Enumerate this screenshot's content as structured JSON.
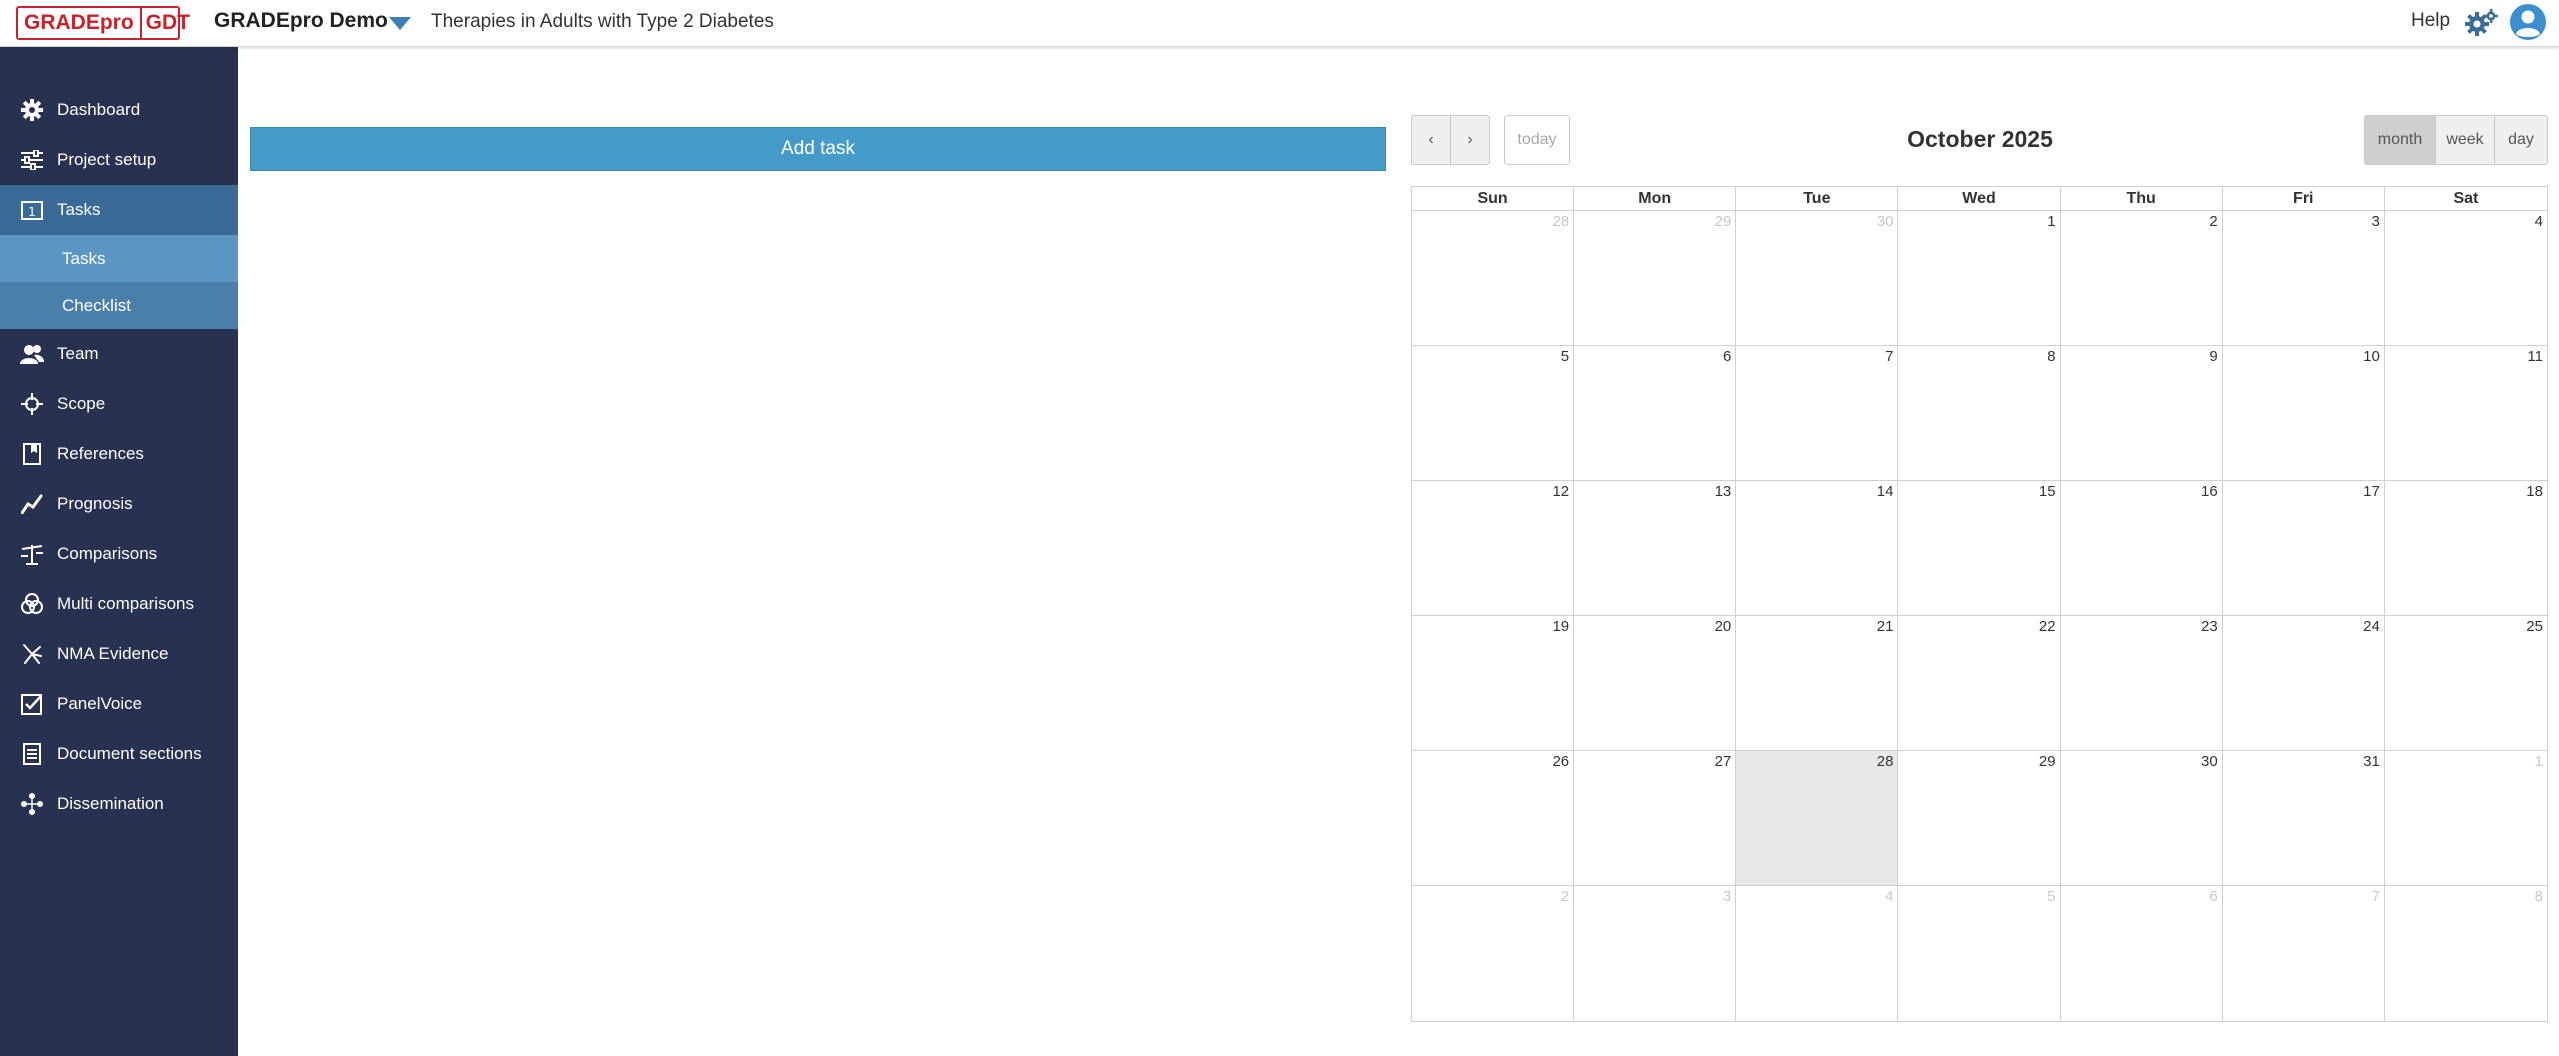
{
  "header": {
    "logo_left": "GRADEpro",
    "logo_right": "GDT",
    "project_name": "GRADEpro Demo",
    "project_title": "Therapies in Adults with Type 2 Diabetes",
    "help": "Help",
    "brand_color": "#c8232c",
    "accent_color": "#459bc8"
  },
  "sidebar": {
    "items": [
      {
        "label": "Dashboard",
        "icon": "gear-icon"
      },
      {
        "label": "Project setup",
        "icon": "sliders-icon"
      },
      {
        "label": "Tasks",
        "icon": "calendar-one-icon"
      },
      {
        "label": "Team",
        "icon": "people-icon"
      },
      {
        "label": "Scope",
        "icon": "crosshair-icon"
      },
      {
        "label": "References",
        "icon": "book-icon"
      },
      {
        "label": "Prognosis",
        "icon": "trend-icon"
      },
      {
        "label": "Comparisons",
        "icon": "scale-icon"
      },
      {
        "label": "Multi comparisons",
        "icon": "venn-icon"
      },
      {
        "label": "NMA Evidence",
        "icon": "network-icon"
      },
      {
        "label": "PanelVoice",
        "icon": "checkbox-icon"
      },
      {
        "label": "Document sections",
        "icon": "document-icon"
      },
      {
        "label": "Dissemination",
        "icon": "share-icon"
      }
    ],
    "subitems": [
      {
        "label": "Tasks"
      },
      {
        "label": "Checklist"
      }
    ]
  },
  "main": {
    "add_task_label": "Add task"
  },
  "calendar": {
    "prev": "‹",
    "next": "›",
    "today": "today",
    "title": "October 2025",
    "views": [
      "month",
      "week",
      "day"
    ],
    "active_view": "month",
    "weekdays": [
      "Sun",
      "Mon",
      "Tue",
      "Wed",
      "Thu",
      "Fri",
      "Sat"
    ],
    "weeks": [
      [
        "28",
        "29",
        "30",
        "1",
        "2",
        "3",
        "4"
      ],
      [
        "5",
        "6",
        "7",
        "8",
        "9",
        "10",
        "11"
      ],
      [
        "12",
        "13",
        "14",
        "15",
        "16",
        "17",
        "18"
      ],
      [
        "19",
        "20",
        "21",
        "22",
        "23",
        "24",
        "25"
      ],
      [
        "26",
        "27",
        "28",
        "29",
        "30",
        "31",
        "1"
      ],
      [
        "2",
        "3",
        "4",
        "5",
        "6",
        "7",
        "8"
      ]
    ],
    "today_date": "28"
  }
}
